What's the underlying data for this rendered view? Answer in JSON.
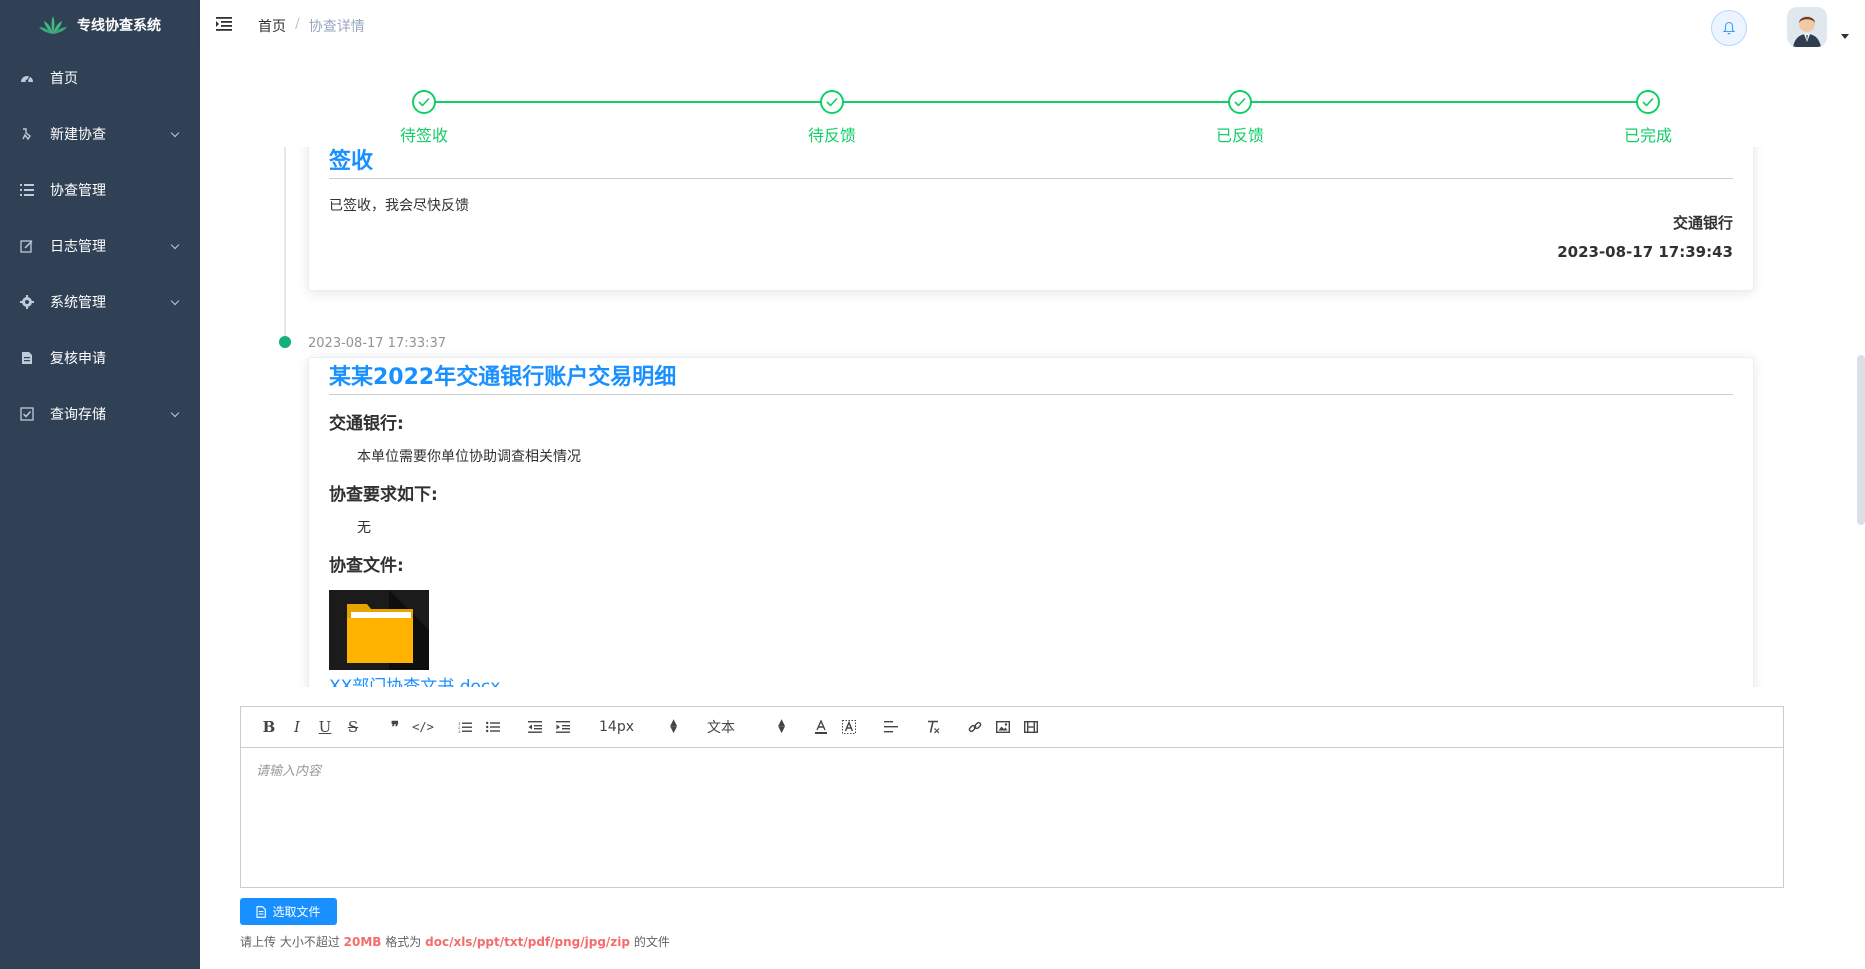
{
  "app": {
    "title": "专线协查系统"
  },
  "sidebar": {
    "items": [
      {
        "label": "首页",
        "icon": "dashboard-icon",
        "expandable": false
      },
      {
        "label": "新建协查",
        "icon": "guide-icon",
        "expandable": true
      },
      {
        "label": "协查管理",
        "icon": "list-icon",
        "expandable": false
      },
      {
        "label": "日志管理",
        "icon": "form-icon",
        "expandable": true
      },
      {
        "label": "系统管理",
        "icon": "system-icon",
        "expandable": true
      },
      {
        "label": "复核申请",
        "icon": "document-icon",
        "expandable": false
      },
      {
        "label": "查询存储",
        "icon": "checkbox-icon",
        "expandable": true
      }
    ]
  },
  "breadcrumb": {
    "home": "首页",
    "separator": "/",
    "current": "协查详情"
  },
  "steps": {
    "items": [
      {
        "label": "待签收",
        "status": "done"
      },
      {
        "label": "待反馈",
        "status": "done"
      },
      {
        "label": "已反馈",
        "status": "done"
      },
      {
        "label": "已完成",
        "status": "done"
      }
    ],
    "color": "#13ce66"
  },
  "timeline": {
    "card1": {
      "title": "签收",
      "body": "已签收，我会尽快反馈",
      "org": "交通银行",
      "time": "2023-08-17 17:39:43"
    },
    "entry2_time": "2023-08-17 17:33:37",
    "card2": {
      "title": "某某2022年交通银行账户交易明细",
      "org_heading": "交通银行:",
      "org_text": "本单位需要你单位协助调查相关情况",
      "req_heading": "协查要求如下:",
      "req_text": "无",
      "file_heading": "协查文件:",
      "file_name": "XX部门协查文书.docx"
    }
  },
  "editor": {
    "font_size": "14px",
    "block_type": "文本",
    "placeholder": "请输入内容",
    "toolbar": [
      "bold-icon",
      "italic-icon",
      "underline-icon",
      "strike-icon",
      "quote-icon",
      "code-icon",
      "ordered-list-icon",
      "bullet-list-icon",
      "outdent-icon",
      "indent-icon",
      "font-size-select",
      "header-select",
      "font-color-icon",
      "background-color-icon",
      "align-icon",
      "clean-format-icon",
      "link-icon",
      "image-icon",
      "video-icon"
    ]
  },
  "upload": {
    "button_label": "选取文件",
    "tip_prefix": "请上传 大小不超过",
    "max_size": "20MB",
    "tip_mid": "格式为",
    "formats": "doc/xls/ppt/txt/pdf/png/jpg/zip",
    "tip_suffix": "的文件"
  },
  "colors": {
    "sidebar_bg": "#304156",
    "accent": "#1890ff",
    "success": "#13ce66",
    "danger": "#f56c6c"
  }
}
